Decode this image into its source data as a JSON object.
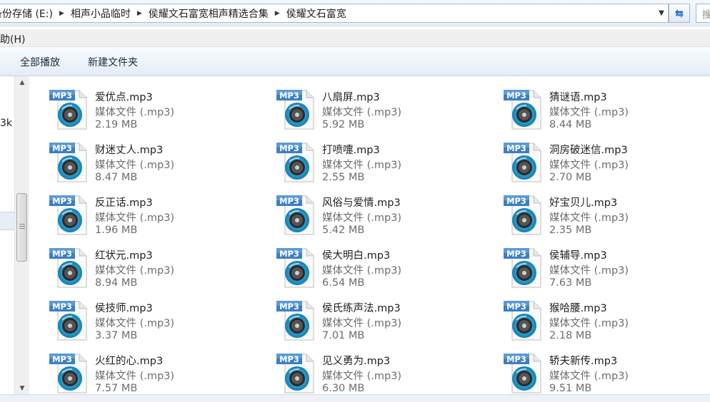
{
  "address_bar": {
    "crumbs": [
      "备份存储 (E:)",
      "相声小品临时",
      "侯耀文石富宽相声精选合集",
      "侯耀文石富宽"
    ],
    "search_placeholder": "搜"
  },
  "menu": {
    "help_label": "帮助(H)"
  },
  "toolbar": {
    "play_all_label": "全部播放",
    "new_folder_label": "新建文件夹"
  },
  "nav_pane": {
    "partial_text": "3k"
  },
  "files": [
    {
      "name": "爱优点.mp3",
      "type": "媒体文件 (.mp3)",
      "size": "2.19 MB"
    },
    {
      "name": "八扇屏.mp3",
      "type": "媒体文件 (.mp3)",
      "size": "5.92 MB"
    },
    {
      "name": "猜谜语.mp3",
      "type": "媒体文件 (.mp3)",
      "size": "8.44 MB"
    },
    {
      "name": "财迷丈人.mp3",
      "type": "媒体文件 (.mp3)",
      "size": "8.47 MB"
    },
    {
      "name": "打喷嚏.mp3",
      "type": "媒体文件 (.mp3)",
      "size": "2.55 MB"
    },
    {
      "name": "洞房破迷信.mp3",
      "type": "媒体文件 (.mp3)",
      "size": "2.70 MB"
    },
    {
      "name": "反正话.mp3",
      "type": "媒体文件 (.mp3)",
      "size": "1.96 MB"
    },
    {
      "name": "风俗与爱情.mp3",
      "type": "媒体文件 (.mp3)",
      "size": "5.42 MB"
    },
    {
      "name": "好宝贝儿.mp3",
      "type": "媒体文件 (.mp3)",
      "size": "2.35 MB"
    },
    {
      "name": "红状元.mp3",
      "type": "媒体文件 (.mp3)",
      "size": "8.94 MB"
    },
    {
      "name": "侯大明白.mp3",
      "type": "媒体文件 (.mp3)",
      "size": "6.54 MB"
    },
    {
      "name": "侯辅导.mp3",
      "type": "媒体文件 (.mp3)",
      "size": "7.63 MB"
    },
    {
      "name": "侯技师.mp3",
      "type": "媒体文件 (.mp3)",
      "size": "3.37 MB"
    },
    {
      "name": "侯氏练声法.mp3",
      "type": "媒体文件 (.mp3)",
      "size": "7.01 MB"
    },
    {
      "name": "猴哈腰.mp3",
      "type": "媒体文件 (.mp3)",
      "size": "2.18 MB"
    },
    {
      "name": "火红的心.mp3",
      "type": "媒体文件 (.mp3)",
      "size": "7.57 MB"
    },
    {
      "name": "见义勇为.mp3",
      "type": "媒体文件 (.mp3)",
      "size": "6.30 MB"
    },
    {
      "name": "轿夫新传.mp3",
      "type": "媒体文件 (.mp3)",
      "size": "9.51 MB"
    }
  ],
  "icon": {
    "badge_text": "MP3",
    "name": "mp3-file-icon",
    "badge_color": "#3c7fc4",
    "disc_color": "#1f9fd0"
  }
}
